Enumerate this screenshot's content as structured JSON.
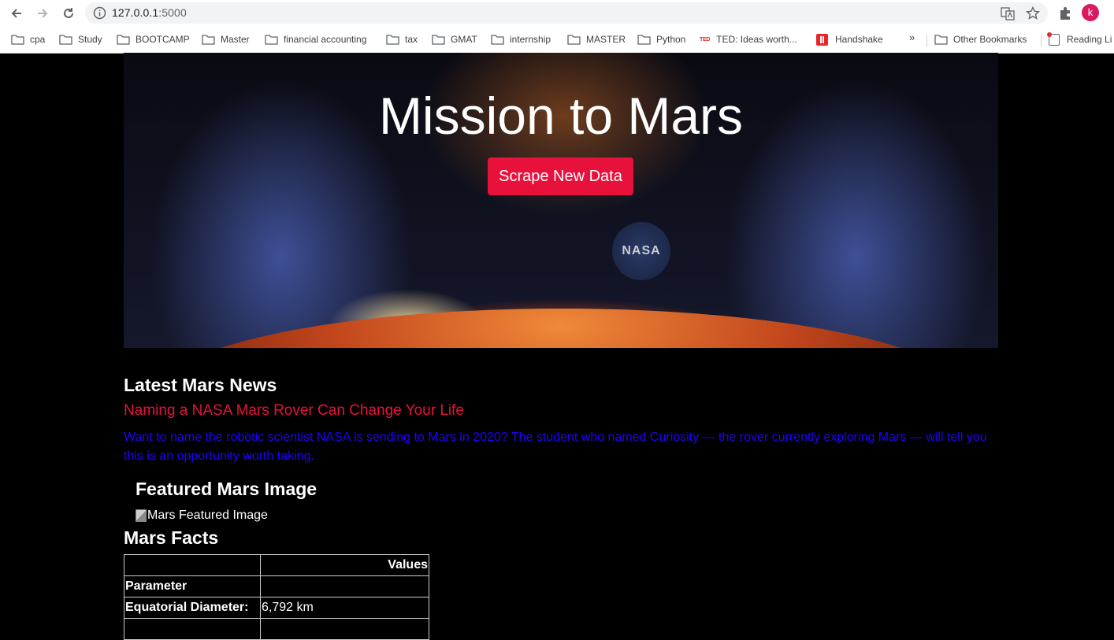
{
  "browser": {
    "url_host": "127.0.0.1",
    "url_port": ":5000",
    "profile_initial": "k",
    "bookmarks": [
      {
        "label": "cpa",
        "icon": "folder-icon"
      },
      {
        "label": "Study",
        "icon": "folder-icon"
      },
      {
        "label": "BOOTCAMP",
        "icon": "folder-icon"
      },
      {
        "label": "Master",
        "icon": "folder-icon"
      },
      {
        "label": "financial accounting",
        "icon": "folder-icon"
      },
      {
        "label": "tax",
        "icon": "folder-icon"
      },
      {
        "label": "GMAT",
        "icon": "folder-icon"
      },
      {
        "label": "internship",
        "icon": "folder-icon"
      },
      {
        "label": "MASTER",
        "icon": "folder-icon"
      },
      {
        "label": "Python",
        "icon": "folder-icon"
      },
      {
        "label": "TED: Ideas worth...",
        "icon": "ted-icon"
      },
      {
        "label": "Handshake",
        "icon": "handshake-icon"
      }
    ],
    "more_label": "»",
    "other_bookmarks": "Other Bookmarks",
    "reading_list": "Reading Li",
    "ted_logo_text": "TED"
  },
  "hero": {
    "title": "Mission to Mars",
    "button_label": "Scrape New Data",
    "badge_text": "NASA"
  },
  "news": {
    "heading": "Latest Mars News",
    "title": "Naming a NASA Mars Rover Can Change Your Life",
    "paragraph": "Want to name the robotic scientist NASA is sending to Mars in 2020? The student who named Curiosity — the rover currently exploring Mars — will tell you this is an opportunity worth taking."
  },
  "featured": {
    "heading": "Featured Mars Image",
    "alt_text": "Mars Featured Image"
  },
  "facts": {
    "heading": "Mars Facts",
    "header": [
      "",
      "Values"
    ],
    "rows": [
      [
        "Parameter",
        ""
      ],
      [
        "Equatorial Diameter:",
        "6,792 km"
      ]
    ]
  },
  "colors": {
    "accent": "#e8113c",
    "link_blue": "#1e00ff",
    "background": "#000000"
  }
}
